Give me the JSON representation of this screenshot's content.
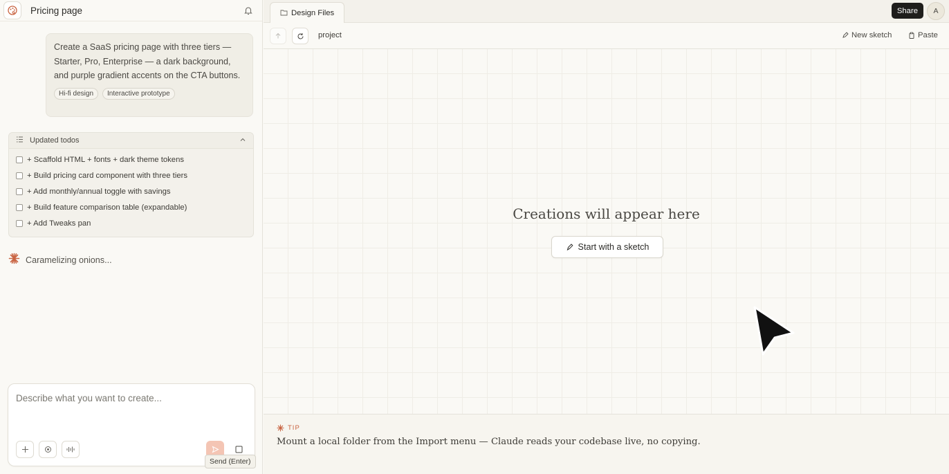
{
  "left_panel": {
    "project_title": "Pricing page",
    "logo_icon": "palette-icon",
    "notification_icon": "bell-icon",
    "user_message": {
      "text": "Create a SaaS pricing page with three tiers — Starter, Pro, Enterprise — a dark background, and purple gradient accents on the CTA buttons.",
      "tags": [
        "Hi-fi design",
        "Interactive prototype"
      ]
    },
    "todos": {
      "title": "Updated todos",
      "items": [
        "+ Scaffold HTML + fonts + dark theme tokens",
        "+ Build pricing card component with three tiers",
        "+ Add monthly/annual toggle with savings",
        "+ Build feature comparison table (expandable)",
        "+ Add Tweaks pan"
      ]
    },
    "status_text": "Caramelizing onions...",
    "composer": {
      "placeholder": "Describe what you want to create...",
      "value": "",
      "send_tooltip": "Send (Enter)"
    }
  },
  "right_panel": {
    "tab_label": "Design Files",
    "share_label": "Share",
    "avatar_initial": "A",
    "path": "project",
    "new_sketch_label": "New sketch",
    "paste_label": "Paste",
    "empty_title": "Creations will appear here",
    "start_sketch_label": "Start with a sketch",
    "tip": {
      "label": "TIP",
      "text": "Mount a local folder from the Import menu — Claude reads your codebase live, no copying."
    }
  },
  "colors": {
    "accent": "#c96442",
    "background": "#faf9f5",
    "share_button": "#1f1e1c"
  }
}
